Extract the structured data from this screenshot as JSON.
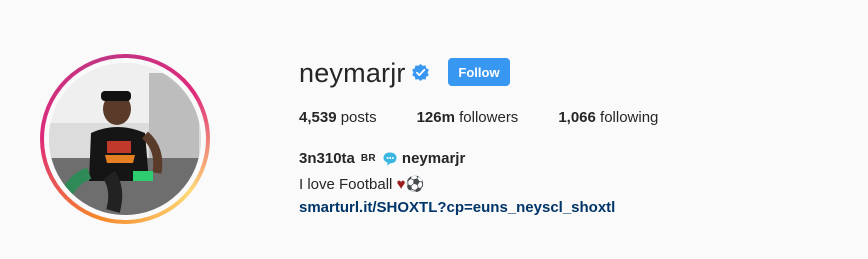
{
  "profile": {
    "username": "neymarjr",
    "follow_label": "Follow",
    "stats": {
      "posts_count": "4,539",
      "posts_label": "posts",
      "followers_count": "126m",
      "followers_label": "followers",
      "following_count": "1,066",
      "following_label": "following"
    },
    "bio": {
      "name": "3n310ta",
      "country_code": "BR",
      "mention": "neymarjr",
      "text": "I love Football",
      "emoji_heart": "♥",
      "emoji_ball": "⚽",
      "link": "smarturl.it/SHOXTL?cp=euns_neyscl_shoxtl"
    },
    "icons": {
      "verified": "verified-badge-icon",
      "bubble": "speech-bubble-icon"
    },
    "colors": {
      "follow_button": "#3897f0",
      "link": "#003569",
      "verified": "#3897f0"
    }
  }
}
